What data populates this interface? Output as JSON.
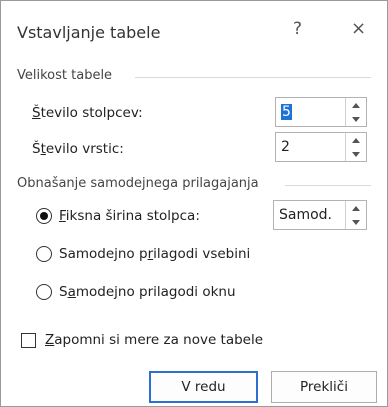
{
  "dialog": {
    "title": "Vstavljanje tabele",
    "help_glyph": "?",
    "close_glyph": "×"
  },
  "table_size": {
    "group_label": "Velikost tabele",
    "columns": {
      "label_u": "Š",
      "label_rest": "tevilo stolpcev:",
      "value": "5"
    },
    "rows": {
      "label_pre": "Š",
      "label_u": "t",
      "label_rest": "evilo vrstic:",
      "value": "2"
    }
  },
  "autofit": {
    "group_label": "Obnašanje samodejnega prilagajanja",
    "fixed": {
      "label_u": "F",
      "label_rest": "iksna širina stolpca:",
      "value": "Samod.",
      "selected": true
    },
    "contents": {
      "label_pre": "Samodejno p",
      "label_u": "r",
      "label_rest": "ilagodi vsebini",
      "selected": false
    },
    "window": {
      "label_pre": "S",
      "label_u": "a",
      "label_rest": "modejno prilagodi oknu",
      "selected": false
    }
  },
  "remember": {
    "label_u": "Z",
    "label_rest": "apomni si mere za nove tabele",
    "checked": false
  },
  "buttons": {
    "ok": "V redu",
    "cancel": "Prekliči"
  },
  "colors": {
    "accent": "#2b6fd0",
    "selection": "#1e73d6"
  }
}
